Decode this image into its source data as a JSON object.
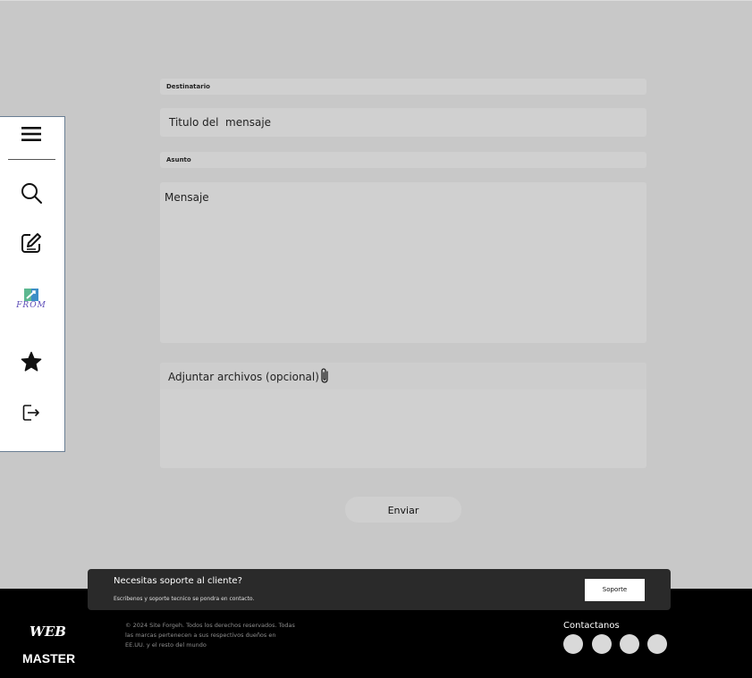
{
  "form": {
    "recipient_label": "Destinatario",
    "title_placeholder": "Titulo del  mensaje",
    "subject_label": "Asunto",
    "message_placeholder": "Mensaje",
    "attach_label": "Adjuntar archivos (opcional)",
    "send_label": "Enviar"
  },
  "sidebar": {
    "items": [
      {
        "name": "menu",
        "icon": "hamburger-icon"
      },
      {
        "name": "search",
        "icon": "search-icon"
      },
      {
        "name": "compose",
        "icon": "edit-icon"
      },
      {
        "name": "from",
        "icon": "from-logo-icon",
        "logo_text": "FROM"
      },
      {
        "name": "favorites",
        "icon": "star-icon"
      },
      {
        "name": "logout",
        "icon": "logout-icon"
      }
    ]
  },
  "banner": {
    "title": "Necesitas soporte al cliente?",
    "subtitle": "Escribenos y soporte tecnico se pondra en contacto.",
    "button_label": "Soporte"
  },
  "footer": {
    "logo_top": "WEB",
    "logo_bottom": "MASTER",
    "copyright": "© 2024 Site Forgeh. Todos los derechos reservados. Todas las marcas pertenecen a sus respectivos dueños en EE.UU. y el resto del mundo",
    "contact_label": "Contactanos"
  },
  "colors": {
    "background": "#c8c8c8",
    "field": "#d0d0d0",
    "sidebar_border": "#6a7e93",
    "footer": "#000000",
    "banner": "#2a2a2a"
  }
}
